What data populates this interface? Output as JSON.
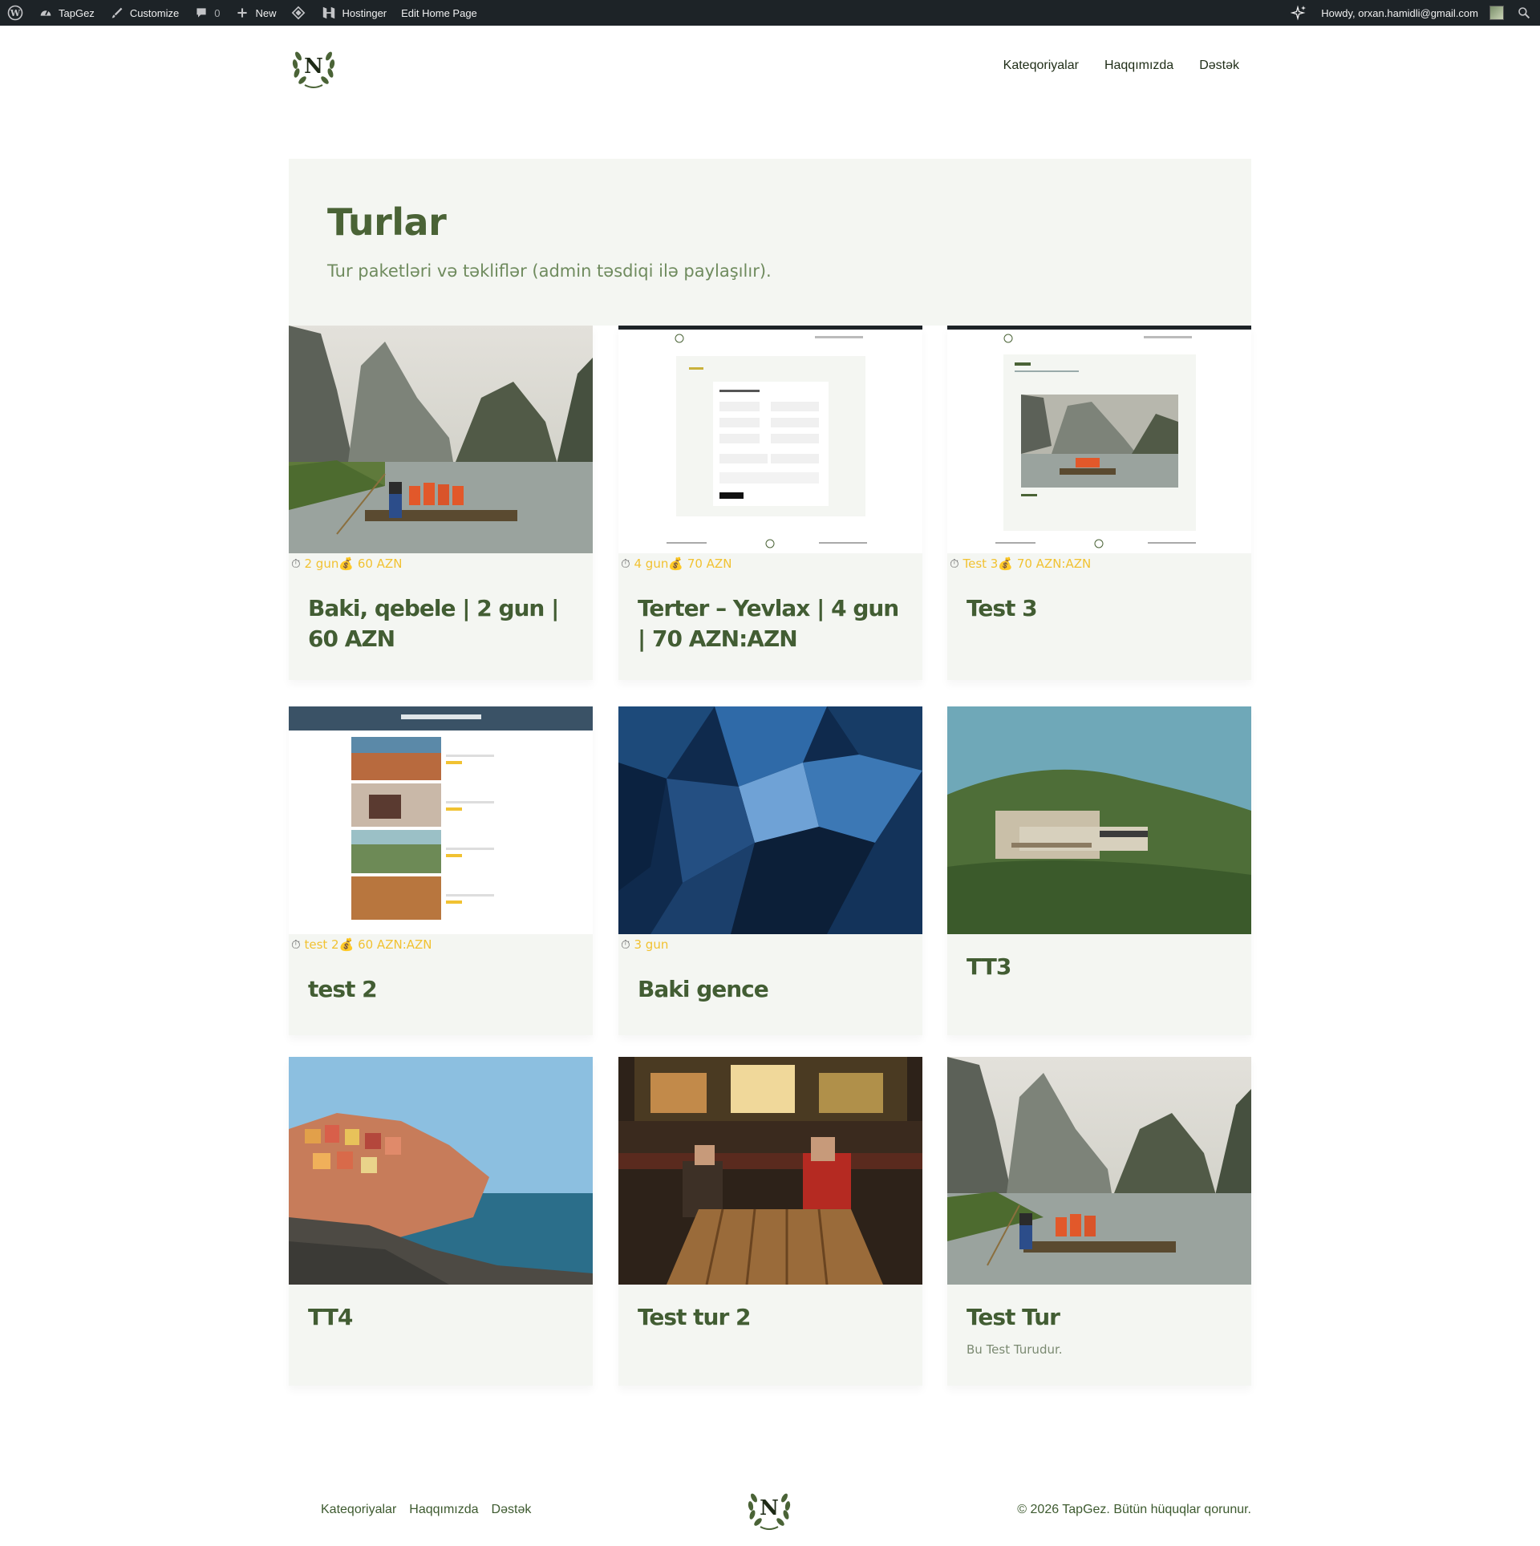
{
  "admin_bar": {
    "site_name": "TapGez",
    "customize": "Customize",
    "comments_count": "0",
    "new_label": "New",
    "hostinger": "Hostinger",
    "edit_page": "Edit Home Page",
    "howdy": "Howdy, orxan.hamidli@gmail.com"
  },
  "header": {
    "logo_letter": "N",
    "nav": [
      "Kateqoriyalar",
      "Haqqımızda",
      "Dəstək"
    ]
  },
  "hero": {
    "title": "Turlar",
    "subtitle": "Tur paketləri və təkliflər (admin təsdiqi ilə paylaşılır)."
  },
  "tours": [
    {
      "title": "Baki, qebele | 2 gun | 60 AZN",
      "meta_duration": "2 gun",
      "meta_price": "60 AZN",
      "image": "river-raft",
      "desc": ""
    },
    {
      "title": "Terter – Yevlax | 4 gun | 70 AZN:AZN",
      "meta_duration": "4 gun",
      "meta_price": "70 AZN",
      "image": "screenshot-form",
      "desc": ""
    },
    {
      "title": "Test 3",
      "meta_duration": "Test 3",
      "meta_price": "70 AZN:AZN",
      "image": "screenshot-tours",
      "desc": ""
    },
    {
      "title": "test 2",
      "meta_duration": "test 2",
      "meta_price": "60 AZN:AZN",
      "image": "screenshot-list",
      "desc": ""
    },
    {
      "title": "Baki gence",
      "meta_duration": "3 gun",
      "meta_price": "",
      "image": "glass-building",
      "desc": ""
    },
    {
      "title": "TT3",
      "meta_duration": "",
      "meta_price": "",
      "image": "hillside-house",
      "desc": ""
    },
    {
      "title": "TT4",
      "meta_duration": "",
      "meta_price": "",
      "image": "coastal-village",
      "desc": ""
    },
    {
      "title": "Test tur 2",
      "meta_duration": "",
      "meta_price": "",
      "image": "cafe-night",
      "desc": ""
    },
    {
      "title": "Test Tur",
      "meta_duration": "",
      "meta_price": "",
      "image": "river-raft",
      "desc": "Bu Test Turudur."
    }
  ],
  "footer": {
    "links": [
      "Kateqoriyalar",
      "Haqqımızda",
      "Dəstək"
    ],
    "logo_letter": "N",
    "copyright": "© 2026 TapGez. Bütün hüquqlar qorunur."
  },
  "colors": {
    "accent": "#4a6336",
    "meta": "#f1c232",
    "card_bg": "#f4f6f2",
    "admin_bar": "#1d2327"
  }
}
